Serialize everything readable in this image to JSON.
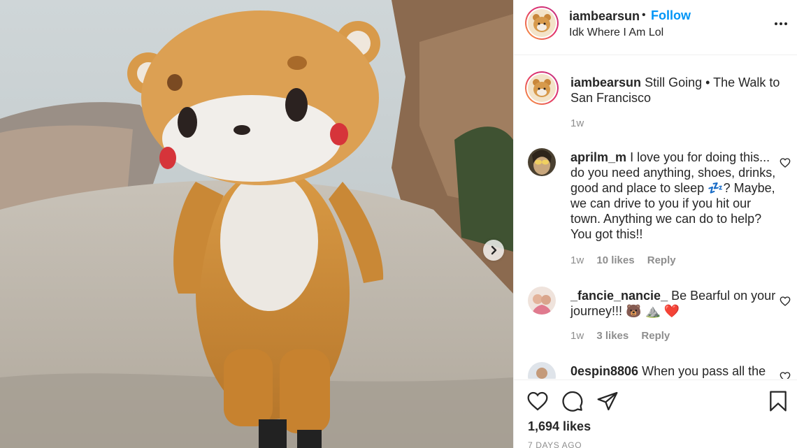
{
  "header": {
    "username": "iambearsun",
    "separator": "•",
    "follow_label": "Follow",
    "location": "Idk Where I Am Lol"
  },
  "caption": {
    "username": "iambearsun",
    "text": "Still Going • The Walk to San Francisco",
    "time": "1w"
  },
  "comments": [
    {
      "username": "aprilm_m",
      "text": "I love you for doing this... do you need anything, shoes, drinks, good and place to sleep 💤? Maybe, we can drive to you if you hit our town. Anything we can do to help? You got this!!",
      "time": "1w",
      "likes": "10 likes",
      "reply_label": "Reply"
    },
    {
      "username": "_fancie_nancie_",
      "text": "Be Bearful on your journey!!! 🐻 ⛰️ ❤️",
      "time": "1w",
      "likes": "3 likes",
      "reply_label": "Reply"
    },
    {
      "username": "0espin8806",
      "text": "When you pass all the"
    }
  ],
  "actions": {
    "likes_count": "1,694 likes",
    "posted": "7 DAYS AGO"
  },
  "icons": {
    "more": "more-options-icon",
    "next": "chevron-right-icon",
    "heart": "heart-icon",
    "comment": "comment-icon",
    "share": "share-icon",
    "save": "bookmark-icon"
  },
  "colors": {
    "follow_blue": "#0095f6",
    "text": "#262626",
    "muted": "#8e8e8e",
    "border": "#efefef"
  }
}
